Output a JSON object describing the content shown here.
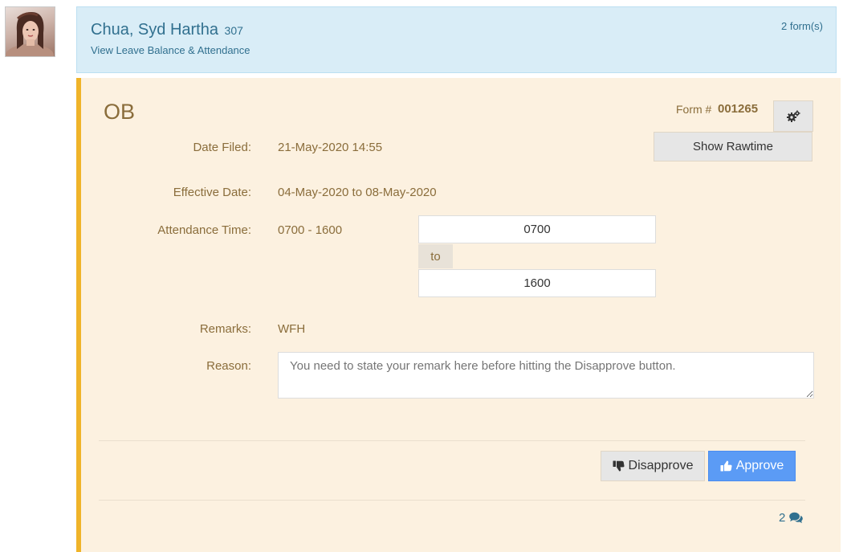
{
  "employee": {
    "name": "Chua, Syd Hartha",
    "id": "307",
    "balance_link": "View Leave Balance & Attendance",
    "forms_count": "2 form(s)"
  },
  "form": {
    "type": "OB",
    "number_label": "Form #",
    "number": "001265",
    "rawtime_label": "Show Rawtime",
    "date_filed_label": "Date Filed:",
    "date_filed": "21-May-2020 14:55",
    "effective_label": "Effective Date:",
    "effective": "04-May-2020 to 08-May-2020",
    "attendance_label": "Attendance Time:",
    "attendance": "0700 - 1600",
    "time_from": "0700",
    "time_to_label": "to",
    "time_to": "1600",
    "remarks_label": "Remarks:",
    "remarks": "WFH",
    "reason_label": "Reason:",
    "reason_placeholder": "You need to state your remark here before hitting the Disapprove button."
  },
  "actions": {
    "disapprove": "Disapprove",
    "approve": "Approve"
  },
  "comments": {
    "count": "2"
  },
  "icons": {
    "gear": "gears-icon",
    "thumbs_down": "thumbs-down-icon",
    "thumbs_up": "thumbs-up-icon",
    "comments": "comments-icon"
  },
  "colors": {
    "info_bg": "#d9edf7",
    "card_bg": "#fcf1e0",
    "accent": "#f0b429",
    "label": "#8a6d3b",
    "link": "#31708f",
    "approve": "#5b9bf5"
  }
}
